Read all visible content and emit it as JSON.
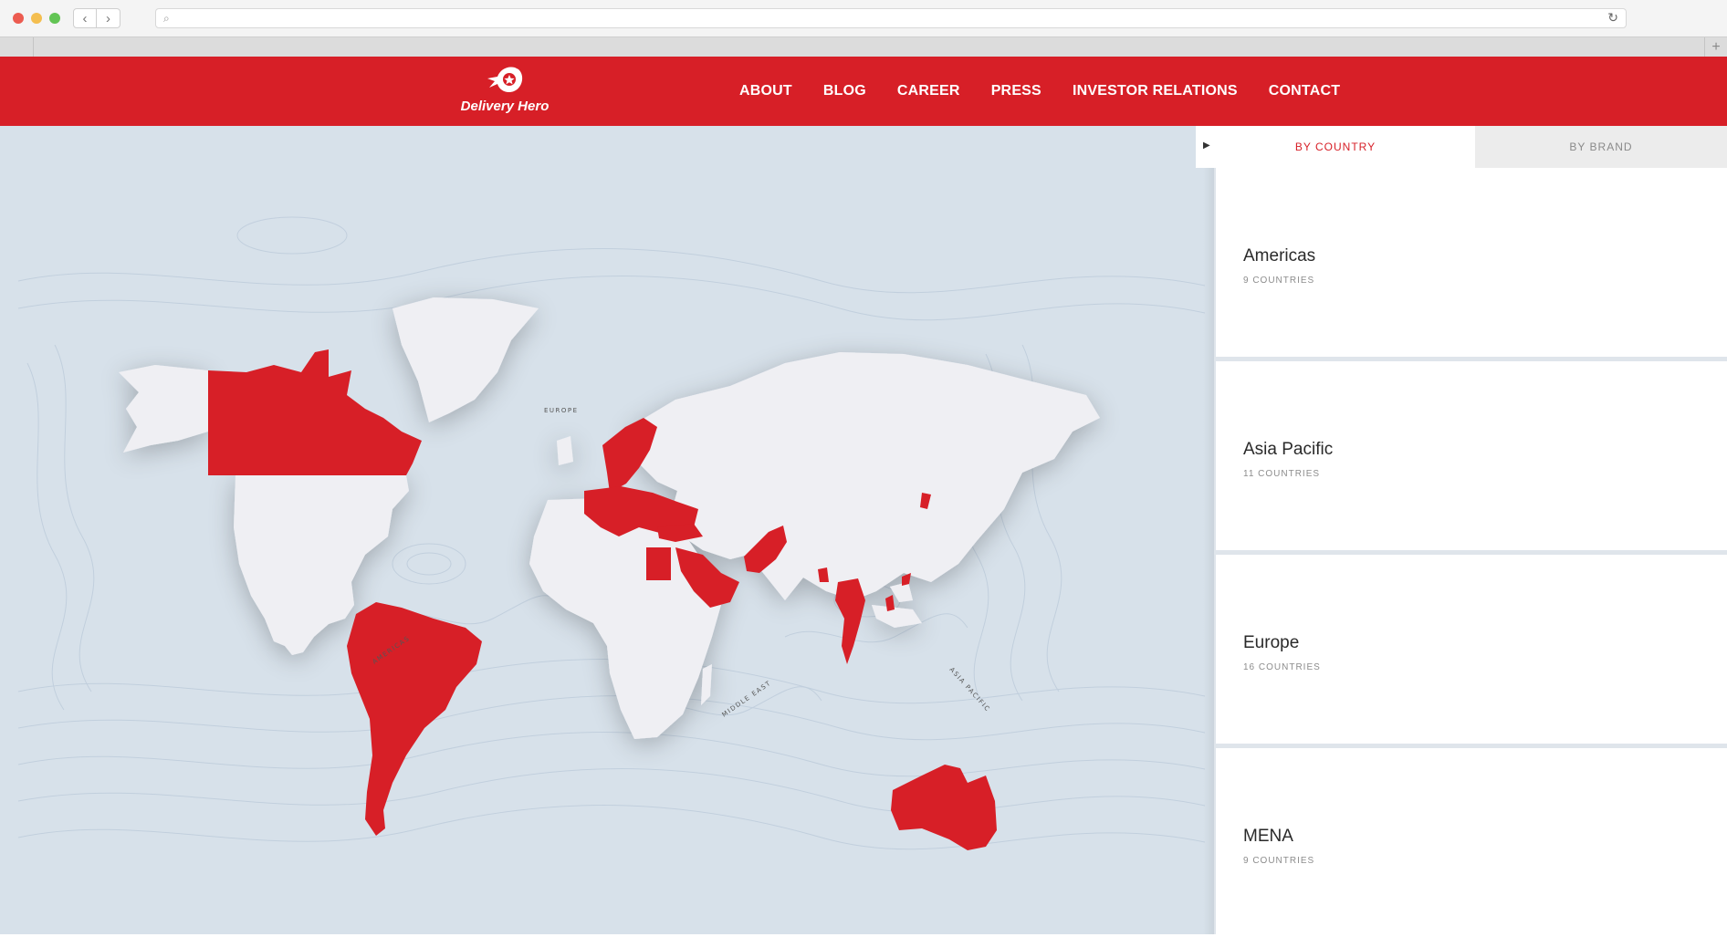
{
  "browser": {
    "back_icon": "chevron-left-icon",
    "forward_icon": "chevron-right-icon",
    "search_icon": "search-icon",
    "reload_icon": "reload-icon",
    "new_tab_label": "+"
  },
  "header": {
    "logo_text": "Delivery Hero",
    "nav": [
      "ABOUT",
      "BLOG",
      "CAREER",
      "PRESS",
      "INVESTOR RELATIONS",
      "CONTACT"
    ],
    "background_color": "#d71f27"
  },
  "map": {
    "labels": {
      "europe": "EUROPE",
      "americas": "AMERICAS",
      "middle_east": "MIDDLE EAST",
      "asia_pacific": "ASIA PACIFIC"
    },
    "highlight_color": "#d71f27",
    "land_color": "#efeff3",
    "sea_color": "#d7e1ea"
  },
  "panel": {
    "tabs": {
      "active_arrow": "▶",
      "by_country": "BY COUNTRY",
      "by_brand": "BY BRAND"
    },
    "regions": [
      {
        "name": "Americas",
        "count": "9 COUNTRIES"
      },
      {
        "name": "Asia Pacific",
        "count": "11 COUNTRIES"
      },
      {
        "name": "Europe",
        "count": "16 COUNTRIES"
      },
      {
        "name": "MENA",
        "count": "9 COUNTRIES"
      }
    ]
  }
}
